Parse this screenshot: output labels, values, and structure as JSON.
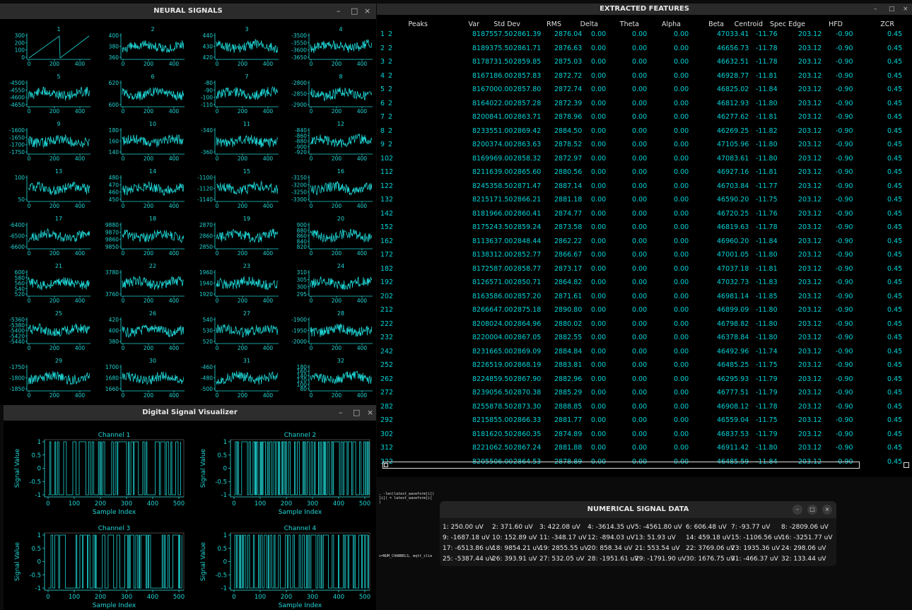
{
  "neural": {
    "title": "NEURAL SIGNALS",
    "controls": [
      "–",
      "□",
      "×"
    ],
    "x_ticks": [
      "0",
      "200",
      "400"
    ],
    "channels": [
      {
        "label": "1",
        "yticks": [
          "300",
          "200",
          "100",
          "0"
        ],
        "style": "saw"
      },
      {
        "label": "2",
        "yticks": [
          "400",
          "380",
          "360"
        ],
        "style": "noise"
      },
      {
        "label": "3",
        "yticks": [
          "440",
          "430",
          "420"
        ],
        "style": "noise"
      },
      {
        "label": "4",
        "yticks": [
          "-3500",
          "-3550",
          "-3600",
          "-3650"
        ],
        "style": "noise"
      },
      {
        "label": "5",
        "yticks": [
          "-4500",
          "-4550",
          "-4600",
          "-4650"
        ],
        "style": "noise"
      },
      {
        "label": "6",
        "yticks": [
          "620",
          "600"
        ],
        "style": "noise"
      },
      {
        "label": "7",
        "yticks": [
          "-80",
          "-90",
          "-100",
          "-110"
        ],
        "style": "noise"
      },
      {
        "label": "8",
        "yticks": [
          "-2800",
          "-2850",
          "-2900"
        ],
        "style": "noise"
      },
      {
        "label": "9",
        "yticks": [
          "-1600",
          "-1650",
          "-1700",
          "-1750"
        ],
        "style": "noise"
      },
      {
        "label": "10",
        "yticks": [
          "180",
          "160",
          "140"
        ],
        "style": "noise"
      },
      {
        "label": "11",
        "yticks": [
          "-340",
          "-360"
        ],
        "style": "noise"
      },
      {
        "label": "12",
        "yticks": [
          "-840",
          "-860",
          "-880",
          "-900",
          "-920"
        ],
        "style": "noise"
      },
      {
        "label": "13",
        "yticks": [
          "100",
          "50"
        ],
        "style": "noise"
      },
      {
        "label": "14",
        "yticks": [
          "480",
          "470",
          "460",
          "450"
        ],
        "style": "noise"
      },
      {
        "label": "15",
        "yticks": [
          "-1100",
          "-1120",
          "-1140"
        ],
        "style": "noise"
      },
      {
        "label": "16",
        "yticks": [
          "-3150",
          "-3200",
          "-3250",
          "-3300"
        ],
        "style": "noise"
      },
      {
        "label": "17",
        "yticks": [
          "-6400",
          "-6500",
          "-6600"
        ],
        "style": "noise"
      },
      {
        "label": "18",
        "yticks": [
          "9880",
          "9870",
          "9860",
          "9850"
        ],
        "style": "noise"
      },
      {
        "label": "19",
        "yticks": [
          "2870",
          "2860",
          "2850"
        ],
        "style": "noise"
      },
      {
        "label": "20",
        "yticks": [
          "900",
          "880",
          "860",
          "840",
          "820"
        ],
        "style": "noise"
      },
      {
        "label": "21",
        "yticks": [
          "600",
          "580",
          "560",
          "540",
          "520"
        ],
        "style": "noise"
      },
      {
        "label": "22",
        "yticks": [
          "3780",
          "3760"
        ],
        "style": "noise"
      },
      {
        "label": "23",
        "yticks": [
          "1960",
          "1940",
          "1920"
        ],
        "style": "noise"
      },
      {
        "label": "24",
        "yticks": [
          "310",
          "305",
          "300",
          "295"
        ],
        "style": "noise"
      },
      {
        "label": "25",
        "yticks": [
          "-5360",
          "-5380",
          "-5400",
          "-5420",
          "-5440"
        ],
        "style": "noise"
      },
      {
        "label": "26",
        "yticks": [
          "420",
          "400",
          "380"
        ],
        "style": "noise"
      },
      {
        "label": "27",
        "yticks": [
          "540",
          "530",
          "520"
        ],
        "style": "noise"
      },
      {
        "label": "28",
        "yticks": [
          "-1900",
          "-1950",
          "-2000"
        ],
        "style": "noise"
      },
      {
        "label": "29",
        "yticks": [
          "-1750",
          "-1800",
          "-1850"
        ],
        "style": "noise"
      },
      {
        "label": "30",
        "yticks": [
          "1700",
          "1680",
          "1660"
        ],
        "style": "noise"
      },
      {
        "label": "31",
        "yticks": [
          "-460",
          "-480",
          "-500"
        ],
        "style": "noise"
      },
      {
        "label": "32",
        "yticks": [
          "180",
          "160",
          "140",
          "120",
          "100",
          "80"
        ],
        "style": "noise"
      }
    ]
  },
  "features": {
    "title": "EXTRACTED FEATURES",
    "controls": [
      "–",
      "□",
      "×"
    ],
    "columns": [
      "Peaks",
      "Var",
      "Std Dev",
      "RMS",
      "Delta",
      "Theta",
      "Alpha",
      "Beta",
      "Centroid",
      "Spec Edge",
      "HFD",
      "ZCR"
    ],
    "rows": [
      [
        "1",
        "2",
        "8187557.50",
        "2861.39",
        "2876.04",
        "0.00",
        "0.00",
        "0.00",
        "47033.41",
        "-11.76",
        "203.12",
        "-0.90",
        "0.45"
      ],
      [
        "2",
        "2",
        "8189375.50",
        "2861.71",
        "2876.63",
        "0.00",
        "0.00",
        "0.00",
        "46656.73",
        "-11.78",
        "203.12",
        "-0.90",
        "0.45"
      ],
      [
        "3",
        "2",
        "8178731.50",
        "2859.85",
        "2875.03",
        "0.00",
        "0.00",
        "0.00",
        "46632.51",
        "-11.78",
        "203.12",
        "-0.90",
        "0.45"
      ],
      [
        "4",
        "2",
        "8167186.00",
        "2857.83",
        "2872.72",
        "0.00",
        "0.00",
        "0.00",
        "46928.77",
        "-11.81",
        "203.12",
        "-0.90",
        "0.45"
      ],
      [
        "5",
        "2",
        "8167000.00",
        "2857.80",
        "2872.74",
        "0.00",
        "0.00",
        "0.00",
        "46825.02",
        "-11.84",
        "203.12",
        "-0.90",
        "0.45"
      ],
      [
        "6",
        "2",
        "8164022.00",
        "2857.28",
        "2872.39",
        "0.00",
        "0.00",
        "0.00",
        "46812.93",
        "-11.80",
        "203.12",
        "-0.90",
        "0.45"
      ],
      [
        "7",
        "2",
        "8200841.00",
        "2863.71",
        "2878.96",
        "0.00",
        "0.00",
        "0.00",
        "46277.62",
        "-11.81",
        "203.12",
        "-0.90",
        "0.45"
      ],
      [
        "8",
        "2",
        "8233551.00",
        "2869.42",
        "2884.50",
        "0.00",
        "0.00",
        "0.00",
        "46269.25",
        "-11.82",
        "203.12",
        "-0.90",
        "0.45"
      ],
      [
        "9",
        "2",
        "8200374.00",
        "2863.63",
        "2878.52",
        "0.00",
        "0.00",
        "0.00",
        "47105.96",
        "-11.80",
        "203.12",
        "-0.90",
        "0.45"
      ],
      [
        "10",
        "2",
        "8169969.00",
        "2858.32",
        "2872.97",
        "0.00",
        "0.00",
        "0.00",
        "47083.61",
        "-11.80",
        "203.12",
        "-0.90",
        "0.45"
      ],
      [
        "11",
        "2",
        "8211639.00",
        "2865.60",
        "2880.56",
        "0.00",
        "0.00",
        "0.00",
        "46927.16",
        "-11.81",
        "203.12",
        "-0.90",
        "0.45"
      ],
      [
        "12",
        "2",
        "8245358.50",
        "2871.47",
        "2887.14",
        "0.00",
        "0.00",
        "0.00",
        "46703.84",
        "-11.77",
        "203.12",
        "-0.90",
        "0.45"
      ],
      [
        "13",
        "2",
        "8215171.50",
        "2866.21",
        "2881.18",
        "0.00",
        "0.00",
        "0.00",
        "46590.20",
        "-11.75",
        "203.12",
        "-0.90",
        "0.45"
      ],
      [
        "14",
        "2",
        "8181966.00",
        "2860.41",
        "2874.77",
        "0.00",
        "0.00",
        "0.00",
        "46720.25",
        "-11.76",
        "203.12",
        "-0.90",
        "0.45"
      ],
      [
        "15",
        "2",
        "8175243.50",
        "2859.24",
        "2873.58",
        "0.00",
        "0.00",
        "0.00",
        "46819.63",
        "-11.78",
        "203.12",
        "-0.90",
        "0.45"
      ],
      [
        "16",
        "2",
        "8113637.00",
        "2848.44",
        "2862.22",
        "0.00",
        "0.00",
        "0.00",
        "46960.20",
        "-11.84",
        "203.12",
        "-0.90",
        "0.45"
      ],
      [
        "17",
        "2",
        "8138312.00",
        "2852.77",
        "2866.67",
        "0.00",
        "0.00",
        "0.00",
        "47001.05",
        "-11.80",
        "203.12",
        "-0.90",
        "0.45"
      ],
      [
        "18",
        "2",
        "8172587.00",
        "2858.77",
        "2873.17",
        "0.00",
        "0.00",
        "0.00",
        "47037.18",
        "-11.81",
        "203.12",
        "-0.90",
        "0.45"
      ],
      [
        "19",
        "2",
        "8126571.00",
        "2850.71",
        "2864.82",
        "0.00",
        "0.00",
        "0.00",
        "47032.73",
        "-11.83",
        "203.12",
        "-0.90",
        "0.45"
      ],
      [
        "20",
        "2",
        "8163586.00",
        "2857.20",
        "2871.61",
        "0.00",
        "0.00",
        "0.00",
        "46981.14",
        "-11.85",
        "203.12",
        "-0.90",
        "0.45"
      ],
      [
        "21",
        "2",
        "8266647.00",
        "2875.18",
        "2890.80",
        "0.00",
        "0.00",
        "0.00",
        "46899.09",
        "-11.80",
        "203.12",
        "-0.90",
        "0.45"
      ],
      [
        "22",
        "2",
        "8208024.00",
        "2864.96",
        "2880.02",
        "0.00",
        "0.00",
        "0.00",
        "46798.82",
        "-11.80",
        "203.12",
        "-0.90",
        "0.45"
      ],
      [
        "23",
        "2",
        "8220004.00",
        "2867.05",
        "2882.55",
        "0.00",
        "0.00",
        "0.00",
        "46378.84",
        "-11.80",
        "203.12",
        "-0.90",
        "0.45"
      ],
      [
        "24",
        "2",
        "8231665.00",
        "2869.09",
        "2884.84",
        "0.00",
        "0.00",
        "0.00",
        "46492.96",
        "-11.74",
        "203.12",
        "-0.90",
        "0.45"
      ],
      [
        "25",
        "2",
        "8226519.00",
        "2868.19",
        "2883.81",
        "0.00",
        "0.00",
        "0.00",
        "46485.25",
        "-11.75",
        "203.12",
        "-0.90",
        "0.45"
      ],
      [
        "26",
        "2",
        "8224859.50",
        "2867.90",
        "2882.96",
        "0.00",
        "0.00",
        "0.00",
        "46295.93",
        "-11.79",
        "203.12",
        "-0.90",
        "0.45"
      ],
      [
        "27",
        "2",
        "8239056.50",
        "2870.38",
        "2885.29",
        "0.00",
        "0.00",
        "0.00",
        "46777.51",
        "-11.79",
        "203.12",
        "-0.90",
        "0.45"
      ],
      [
        "28",
        "2",
        "8255878.50",
        "2873.30",
        "2888.85",
        "0.00",
        "0.00",
        "0.00",
        "46908.12",
        "-11.78",
        "203.12",
        "-0.90",
        "0.45"
      ],
      [
        "29",
        "2",
        "8215855.00",
        "2866.33",
        "2881.77",
        "0.00",
        "0.00",
        "0.00",
        "46559.04",
        "-11.75",
        "203.12",
        "-0.90",
        "0.45"
      ],
      [
        "30",
        "2",
        "8181620.50",
        "2860.35",
        "2874.89",
        "0.00",
        "0.00",
        "0.00",
        "46837.53",
        "-11.79",
        "203.12",
        "-0.90",
        "0.45"
      ],
      [
        "31",
        "2",
        "8221062.50",
        "2867.24",
        "2881.88",
        "0.00",
        "0.00",
        "0.00",
        "46911.42",
        "-11.80",
        "203.12",
        "-0.90",
        "0.45"
      ],
      [
        "32",
        "2",
        "8205506.00",
        "2864.53",
        "2878.89",
        "0.00",
        "0.00",
        "0.00",
        "46485.59",
        "-11.84",
        "203.12",
        "-0.90",
        "0.45"
      ]
    ]
  },
  "code_snippet": {
    "lines": [
      ", -len(latest_waveform[i])",
      "[i]) = latest_waveform[i]",
      ")"
    ],
    "line2": "s=NUM_CHANNELS, mqtt_clie"
  },
  "digital": {
    "title": "Digital Signal Visualizer",
    "controls": [
      "–",
      "□",
      "×"
    ],
    "xlabel": "Sample Index",
    "ylabel": "Signal Value",
    "x_ticks": [
      "0",
      "100",
      "200",
      "300",
      "400",
      "500"
    ],
    "y_ticks": [
      "1",
      "0.5",
      "0",
      "-0.5",
      "-1"
    ],
    "channels": [
      "Channel 1",
      "Channel 2",
      "Channel 3",
      "Channel 4"
    ]
  },
  "numeric": {
    "title": "NUMERICAL SIGNAL DATA",
    "controls": [
      "–",
      "□",
      "×"
    ],
    "items": [
      "1: 250.00 uV",
      "2: 371.60 uV",
      "3: 422.08 uV",
      "4: -3614.35 uV",
      "5: -4561.80 uV",
      "6: 606.48 uV",
      "7: -93.77 uV",
      "8: -2809.06 uV",
      "9: -1687.18 uV",
      "10: 152.89 uV",
      "11: -348.17 uV",
      "12: -894.03 uV",
      "13: 51.93 uV",
      "14: 459.18 uV",
      "15: -1106.56 uV",
      "16: -3251.77 uV",
      "17: -6513.86 uV",
      "18: 9854.21 uV",
      "19: 2855.55 uV",
      "20: 858.34 uV",
      "21: 553.54 uV",
      "22: 3769.06 uV",
      "23: 1935.36 uV",
      "24: 298.06 uV",
      "25: -5387.44 uV",
      "26: 393.91 uV",
      "27: 532.05 uV",
      "28: -1951.61 uV",
      "29: -1791.90 uV",
      "30: 1676.75 uV",
      "31: -466.37 uV",
      "32: 133.44 uV"
    ]
  },
  "colors": {
    "signal": "#1fd6d6",
    "text_accent": "#00d4d8",
    "background": "#000000"
  }
}
